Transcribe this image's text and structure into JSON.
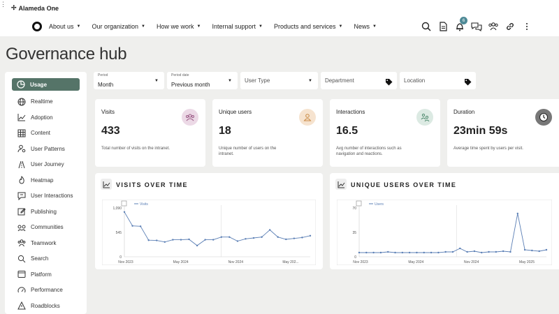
{
  "app": {
    "name": "Alameda One"
  },
  "nav": [
    {
      "label": "About us"
    },
    {
      "label": "Our organization"
    },
    {
      "label": "How we work"
    },
    {
      "label": "Internal support"
    },
    {
      "label": "Products and services"
    },
    {
      "label": "News"
    }
  ],
  "notifications": {
    "count": "6"
  },
  "page": {
    "title": "Governance hub"
  },
  "sidebar": {
    "items": [
      {
        "label": "Usage",
        "icon": "pie-chart-icon"
      },
      {
        "label": "Realtime",
        "icon": "globe-icon"
      },
      {
        "label": "Adoption",
        "icon": "trend-icon"
      },
      {
        "label": "Content",
        "icon": "grid-icon"
      },
      {
        "label": "User Patterns",
        "icon": "user-gear-icon"
      },
      {
        "label": "User Journey",
        "icon": "journey-icon"
      },
      {
        "label": "Heatmap",
        "icon": "flame-icon"
      },
      {
        "label": "User Interactions",
        "icon": "chat-icon"
      },
      {
        "label": "Publishing",
        "icon": "edit-icon"
      },
      {
        "label": "Communities",
        "icon": "communities-icon"
      },
      {
        "label": "Teamwork",
        "icon": "team-icon"
      },
      {
        "label": "Search",
        "icon": "search-icon"
      },
      {
        "label": "Platform",
        "icon": "platform-icon"
      },
      {
        "label": "Performance",
        "icon": "gauge-icon"
      },
      {
        "label": "Roadblocks",
        "icon": "warning-icon"
      }
    ]
  },
  "filters": {
    "period": {
      "label": "Period",
      "value": "Month"
    },
    "period_date": {
      "label": "Period date",
      "value": "Previous month"
    },
    "user_type": {
      "placeholder": "User Type"
    },
    "department": {
      "placeholder": "Department"
    },
    "location": {
      "placeholder": "Location"
    }
  },
  "metrics": {
    "visits": {
      "title": "Visits",
      "value": "433",
      "desc": "Total number of visits on the intranet.",
      "color": "#ecd9e6"
    },
    "unique_users": {
      "title": "Unique users",
      "value": "18",
      "desc": "Unique number of users on the intranet.",
      "color": "#f6e3cf"
    },
    "interactions": {
      "title": "Interactions",
      "value": "16.5",
      "desc": "Avg number of interactions such as navigation and reactions.",
      "color": "#dceae3"
    },
    "duration": {
      "title": "Duration",
      "value": "23min 59s",
      "desc": "Average time spent by users per visit.",
      "color": "#777777"
    }
  },
  "panels": {
    "visits_over_time": {
      "title": "VISITS OVER TIME"
    },
    "unique_users_over_time": {
      "title": "UNIQUE USERS OVER TIME"
    }
  },
  "chart_data": [
    {
      "type": "line",
      "title": "VISITS OVER TIME",
      "series": [
        {
          "name": "Visits",
          "values": [
            1000,
            690,
            680,
            370,
            365,
            330,
            380,
            380,
            390,
            250,
            380,
            380,
            440,
            440,
            350,
            400,
            420,
            440,
            600,
            440,
            390,
            410,
            430,
            470
          ]
        }
      ],
      "x_tick_labels": [
        "Nov 2023",
        "May 2024",
        "Nov 2024",
        "May 202..."
      ],
      "y_tick_labels": [
        "0",
        "545",
        "1,090"
      ],
      "ylim": [
        0,
        1090
      ],
      "color": "#5b7fb5"
    },
    {
      "type": "line",
      "title": "UNIQUE USERS OVER TIME",
      "series": [
        {
          "name": "Users",
          "values": [
            6,
            6,
            6,
            6,
            7,
            6,
            6,
            6,
            6,
            6,
            6,
            6,
            7,
            7,
            12,
            7,
            8,
            6,
            7,
            7,
            8,
            7,
            62,
            10,
            9,
            8,
            10
          ]
        }
      ],
      "x_tick_labels": [
        "Nov 2023",
        "May 2024",
        "Nov 2024",
        "May 2025"
      ],
      "y_tick_labels": [
        "0",
        "35",
        "70"
      ],
      "ylim": [
        0,
        70
      ],
      "color": "#5b7fb5"
    }
  ]
}
